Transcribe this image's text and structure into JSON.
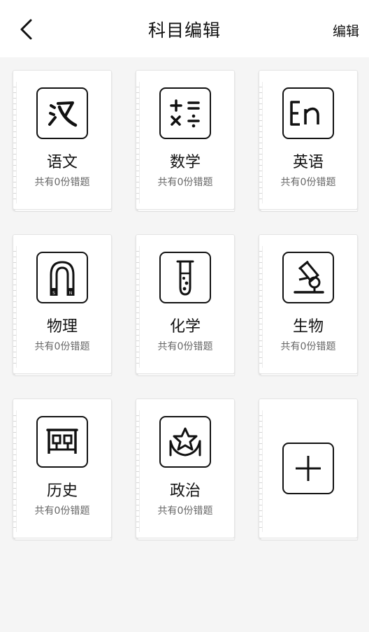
{
  "header": {
    "title": "科目编辑",
    "edit_label": "编辑"
  },
  "subjects": [
    {
      "name": "语文",
      "count_text": "共有0份错题",
      "icon": "chinese-icon"
    },
    {
      "name": "数学",
      "count_text": "共有0份错题",
      "icon": "math-icon"
    },
    {
      "name": "英语",
      "count_text": "共有0份错题",
      "icon": "english-icon"
    },
    {
      "name": "物理",
      "count_text": "共有0份错题",
      "icon": "magnet-icon"
    },
    {
      "name": "化学",
      "count_text": "共有0份错题",
      "icon": "test-tube-icon"
    },
    {
      "name": "生物",
      "count_text": "共有0份错题",
      "icon": "microscope-icon"
    },
    {
      "name": "历史",
      "count_text": "共有0份错题",
      "icon": "history-icon"
    },
    {
      "name": "政治",
      "count_text": "共有0份错题",
      "icon": "star-icon"
    }
  ],
  "add_card": {
    "icon": "plus-icon"
  },
  "colors": {
    "background": "#f5f5f5",
    "card": "#ffffff",
    "ink": "#111111",
    "muted": "#666666"
  }
}
